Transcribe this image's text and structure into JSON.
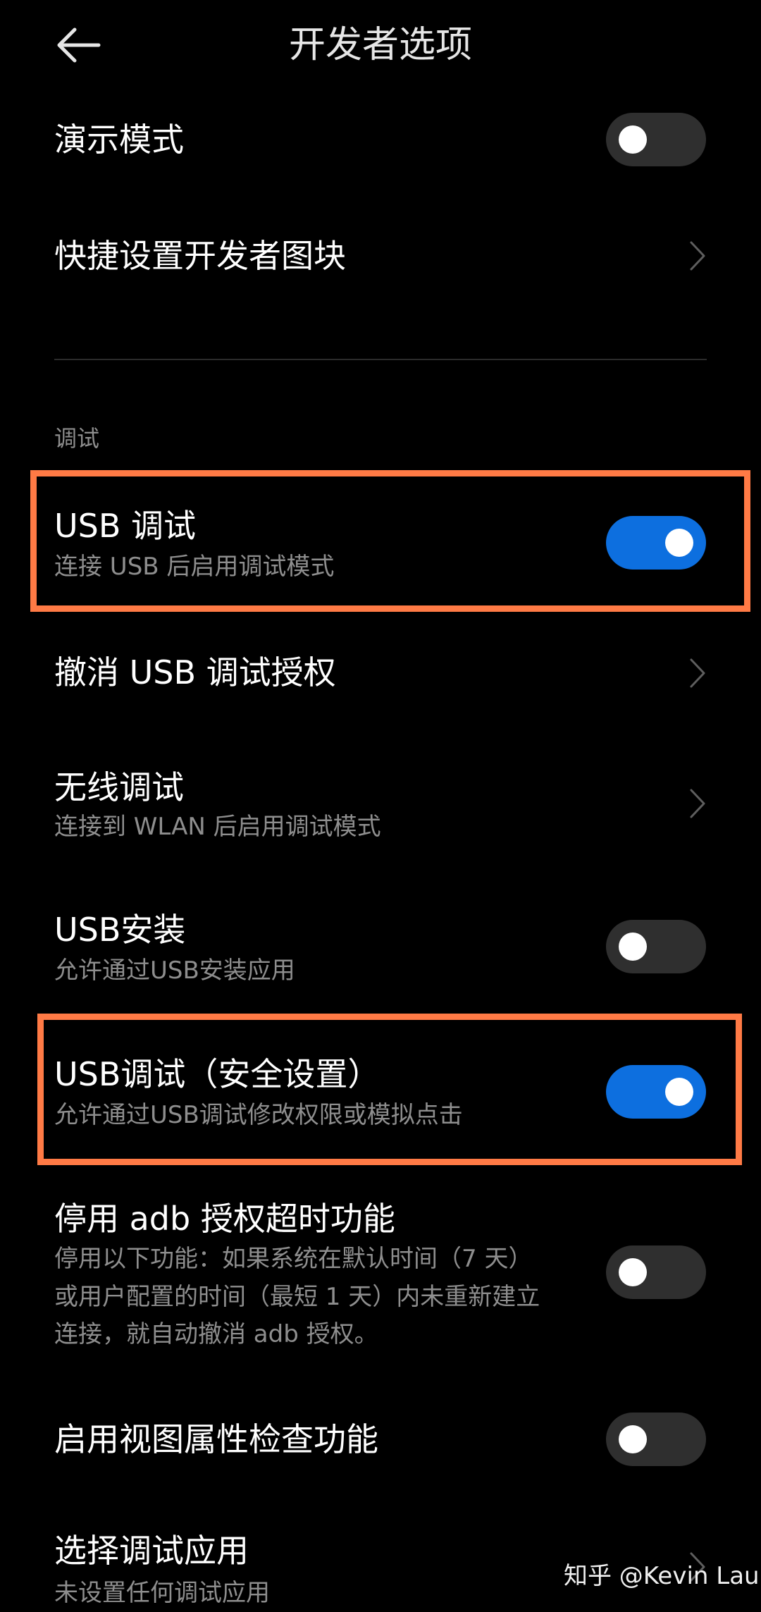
{
  "header": {
    "title": "开发者选项"
  },
  "rows": {
    "demo_mode": {
      "title": "演示模式",
      "toggle_on": false
    },
    "quick_settings_tiles": {
      "title": "快捷设置开发者图块"
    },
    "usb_debugging": {
      "title": "USB 调试",
      "subtitle": "连接 USB 后启用调试模式",
      "toggle_on": true
    },
    "revoke_usb_auth": {
      "title": "撤消 USB 调试授权"
    },
    "wireless_debugging": {
      "title": "无线调试",
      "subtitle": "连接到 WLAN 后启用调试模式"
    },
    "usb_install": {
      "title": "USB安装",
      "subtitle": "允许通过USB安装应用",
      "toggle_on": false
    },
    "usb_debug_security": {
      "title": "USB调试（安全设置）",
      "subtitle": "允许通过USB调试修改权限或模拟点击",
      "toggle_on": true
    },
    "disable_adb_timeout": {
      "title": "停用 adb 授权超时功能",
      "subtitle_lines": [
        "停用以下功能：如果系统在默认时间（7 天）",
        "或用户配置的时间（最短 1 天）内未重新建立",
        "连接，就自动撤消 adb 授权。"
      ],
      "toggle_on": false
    },
    "view_attribute_inspection": {
      "title": "启用视图属性检查功能",
      "toggle_on": false
    },
    "select_debug_app": {
      "title": "选择调试应用",
      "subtitle": "未设置任何调试应用"
    }
  },
  "sections": {
    "debugging": "调试"
  },
  "watermark": "知乎 @Kevin Lau",
  "colors": {
    "background": "#000000",
    "accent_blue": "#0d6fdf",
    "highlight_orange": "#ff7a45",
    "secondary_text": "#8e8e8e"
  },
  "icons": {
    "back": "back-arrow-icon",
    "chevron": "chevron-right-icon"
  }
}
